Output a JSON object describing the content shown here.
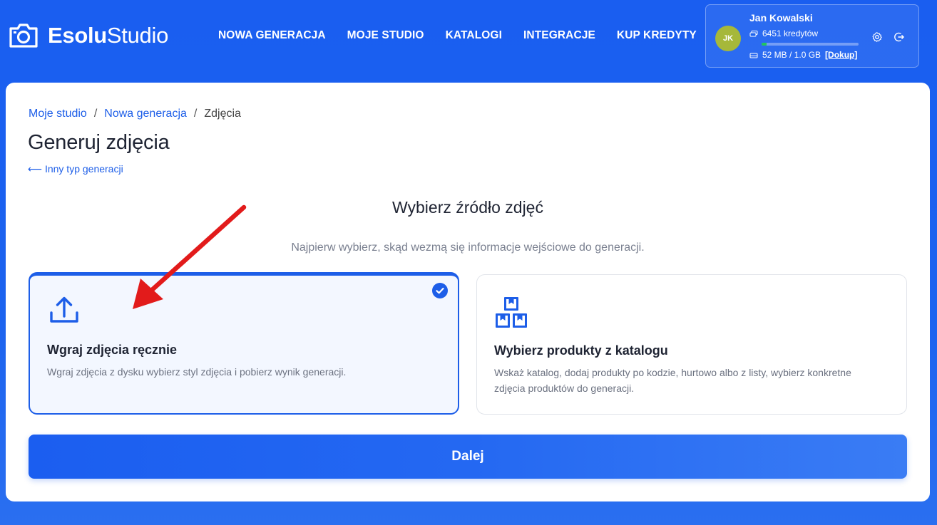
{
  "header": {
    "logo_bold": "Esolu",
    "logo_regular": "Studio",
    "nav": [
      "NOWA GENERACJA",
      "MOJE STUDIO",
      "KATALOGI",
      "INTEGRACJE",
      "KUP KREDYTY"
    ],
    "user": {
      "initials": "JK",
      "name": "Jan Kowalski",
      "credits": "6451 kredytów",
      "storage": "52 MB / 1.0 GB",
      "storage_fraction": 0.05,
      "topup": "[Dokup]"
    },
    "icons": [
      "stack-icon",
      "hard-drive-icon",
      "settings-icon",
      "logout-icon"
    ]
  },
  "breadcrumb": {
    "items": [
      "Moje studio",
      "Nowa generacja"
    ],
    "current": "Zdjęcia",
    "separator": "/"
  },
  "page": {
    "title": "Generuj zdjęcia",
    "back": "⟵ Inny typ generacji",
    "section_title": "Wybierz źródło zdjęć",
    "section_subtitle": "Najpierw wybierz, skąd wezmą się informacje wejściowe do generacji."
  },
  "options": [
    {
      "title": "Wgraj zdjęcia ręcznie",
      "description": "Wgraj zdjęcia z dysku wybierz styl zdjęcia i pobierz wynik generacji.",
      "selected": true,
      "icon": "upload-icon"
    },
    {
      "title": "Wybierz produkty z katalogu",
      "description": "Wskaż katalog, dodaj produkty po kodzie, hurtowo albo z listy, wybierz konkretne zdjęcia produktów do generacji.",
      "selected": false,
      "icon": "boxes-icon"
    }
  ],
  "next_button": "Dalej",
  "colors": {
    "primary": "#1d5ee8",
    "background": "#1a5ef0",
    "avatar": "#a6b83a",
    "progress": "#22c55e",
    "annotation_arrow": "#e21b1b"
  }
}
